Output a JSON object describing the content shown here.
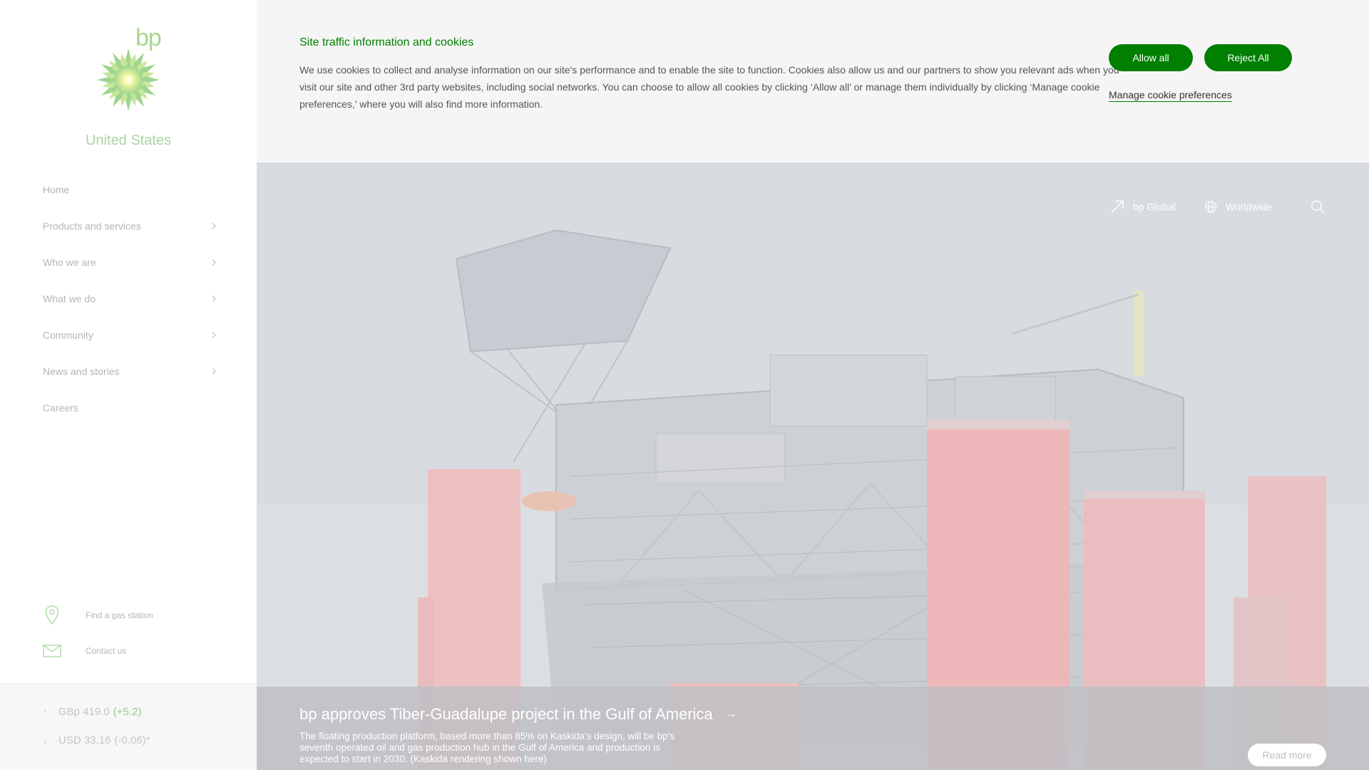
{
  "brand": {
    "logo_text": "bp",
    "country": "United States",
    "colors": {
      "green": "#007f00",
      "logo_green": "#a6d98f",
      "logo_yellow": "#f4f27a"
    }
  },
  "nav": {
    "items": [
      {
        "label": "Home",
        "has_submenu": false
      },
      {
        "label": "Products and services",
        "has_submenu": true
      },
      {
        "label": "Who we are",
        "has_submenu": true
      },
      {
        "label": "What we do",
        "has_submenu": true
      },
      {
        "label": "Community",
        "has_submenu": true
      },
      {
        "label": "News and stories",
        "has_submenu": true
      },
      {
        "label": "Careers",
        "has_submenu": false
      }
    ]
  },
  "utility": {
    "gas_station": {
      "label": "Find a gas station",
      "icon": "map-pin-icon"
    },
    "contact": {
      "label": "Contact us",
      "icon": "envelope-icon"
    }
  },
  "stock": {
    "gbp": {
      "value": "GBp 419.0",
      "change": "(+5.2)",
      "direction": "up"
    },
    "usd": {
      "value": "USD 33.16",
      "change": "(-0.06)*",
      "direction": "down"
    }
  },
  "topbar": {
    "global": {
      "label": "bp Global",
      "icon": "external-arrow-icon"
    },
    "region": {
      "label": "Worldwide",
      "icon": "globe-icon"
    },
    "search": {
      "icon": "search-icon"
    }
  },
  "hero": {
    "headline": "bp approves Tiber-Guadalupe project in the Gulf of America",
    "description": "The floating production platform, based more than 85% on Kaskida's design, will be bp's seventh operated oil and gas production hub in the Gulf of America and production is expected to start in 2030. (Kaskida rendering shown here)",
    "read_more": "Read more"
  },
  "cookie": {
    "title": "Site traffic information and cookies",
    "text": "We use cookies to collect and analyse information on our site's performance and to enable the site to function. Cookies also allow us and our partners to show you relevant ads when you visit our site and other 3rd party websites, including social networks. You can choose to allow all cookies by clicking ‘Allow all’ or manage them individually by clicking ‘Manage cookie preferences,’ where you will also find more information.",
    "allow_all": "Allow all",
    "reject_all": "Reject All",
    "manage": "Manage cookie preferences"
  }
}
